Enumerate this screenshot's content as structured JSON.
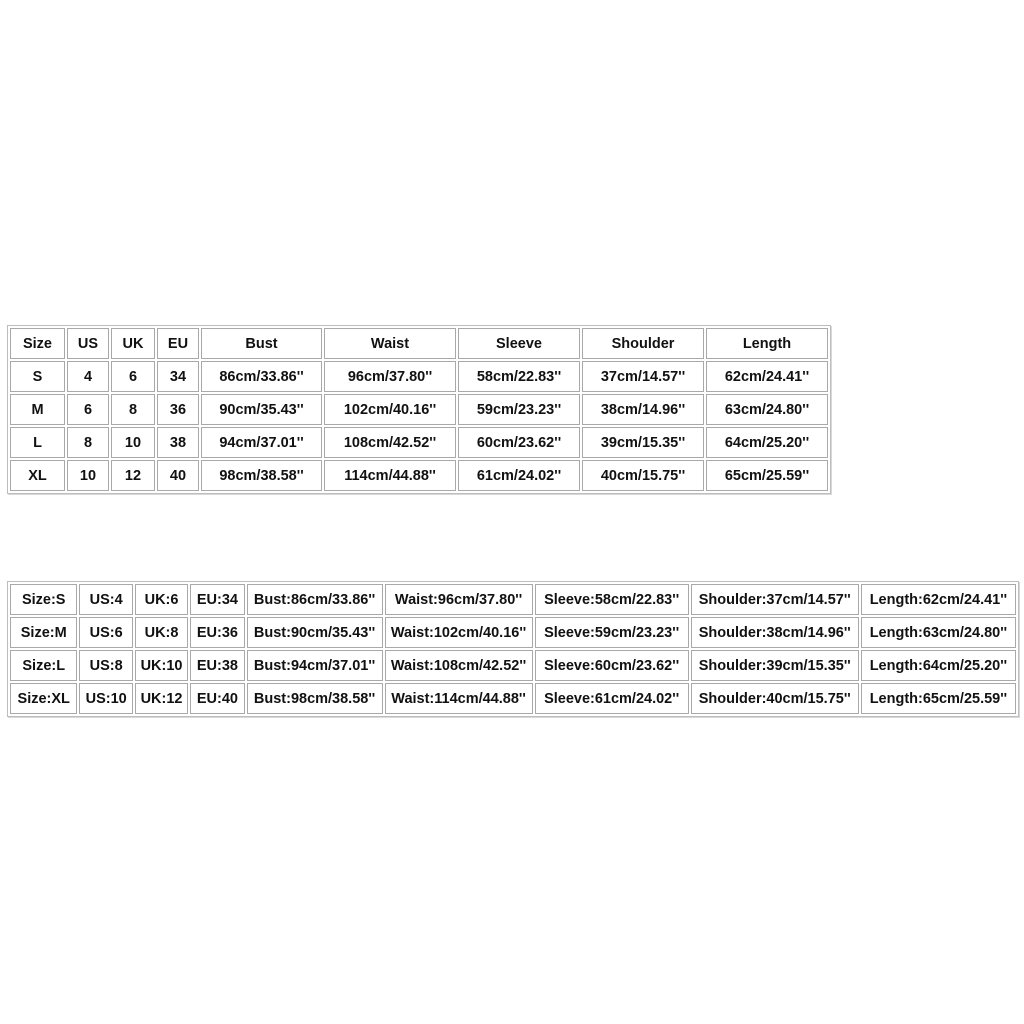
{
  "table1": {
    "headers": [
      "Size",
      "US",
      "UK",
      "EU",
      "Bust",
      "Waist",
      "Sleeve",
      "Shoulder",
      "Length"
    ],
    "rows": [
      [
        "S",
        "4",
        "6",
        "34",
        "86cm/33.86''",
        "96cm/37.80''",
        "58cm/22.83''",
        "37cm/14.57''",
        "62cm/24.41''"
      ],
      [
        "M",
        "6",
        "8",
        "36",
        "90cm/35.43''",
        "102cm/40.16''",
        "59cm/23.23''",
        "38cm/14.96''",
        "63cm/24.80''"
      ],
      [
        "L",
        "8",
        "10",
        "38",
        "94cm/37.01''",
        "108cm/42.52''",
        "60cm/23.62''",
        "39cm/15.35''",
        "64cm/25.20''"
      ],
      [
        "XL",
        "10",
        "12",
        "40",
        "98cm/38.58''",
        "114cm/44.88''",
        "61cm/24.02''",
        "40cm/15.75''",
        "65cm/25.59''"
      ]
    ]
  },
  "table2": {
    "rows": [
      [
        "Size:S",
        "US:4",
        "UK:6",
        "EU:34",
        "Bust:86cm/33.86''",
        "Waist:96cm/37.80''",
        "Sleeve:58cm/22.83''",
        "Shoulder:37cm/14.57''",
        "Length:62cm/24.41''"
      ],
      [
        "Size:M",
        "US:6",
        "UK:8",
        "EU:36",
        "Bust:90cm/35.43''",
        "Waist:102cm/40.16''",
        "Sleeve:59cm/23.23''",
        "Shoulder:38cm/14.96''",
        "Length:63cm/24.80''"
      ],
      [
        "Size:L",
        "US:8",
        "UK:10",
        "EU:38",
        "Bust:94cm/37.01''",
        "Waist:108cm/42.52''",
        "Sleeve:60cm/23.62''",
        "Shoulder:39cm/15.35''",
        "Length:64cm/25.20''"
      ],
      [
        "Size:XL",
        "US:10",
        "UK:12",
        "EU:40",
        "Bust:98cm/38.58''",
        "Waist:114cm/44.88''",
        "Sleeve:61cm/24.02''",
        "Shoulder:40cm/15.75''",
        "Length:65cm/25.59''"
      ]
    ]
  }
}
